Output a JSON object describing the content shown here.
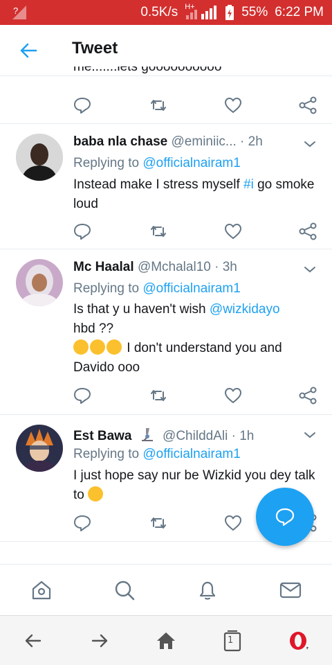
{
  "status_bar": {
    "sim_indicator": "?",
    "network_speed": "0.5K/s",
    "network_type": "H+",
    "battery": "55%",
    "time": "6:22 PM",
    "accent": "#d32f2f"
  },
  "header": {
    "title": "Tweet",
    "back_icon": "arrow-left-icon"
  },
  "previous_tweet": {
    "partial_text": "me.......lets goooooooooo"
  },
  "tweets": [
    {
      "name": "baba nla chase",
      "handle": "@eminiic...",
      "separator": "·",
      "time": "2h",
      "replying_prefix": "Replying to",
      "replying_to": "@officialnairam1",
      "text_before": "Instead make I stress myself ",
      "hashtag": "#i",
      "text_after": " go smoke loud"
    },
    {
      "name": "Mc Haalal",
      "handle": "@Mchalal10",
      "separator": "·",
      "time": "3h",
      "replying_prefix": "Replying to",
      "replying_to": "@officialnairam1",
      "text_before": "Is that y u haven't wish ",
      "mention": "@wizkidayo",
      "text_line2": "hbd ??",
      "text_line3": " I don't understand you and Davido ooo"
    },
    {
      "name": "Est Bawa",
      "name_icon": "microscope-icon",
      "handle": "@ChilddAli",
      "separator": "·",
      "time": "1h",
      "replying_prefix": "Replying to",
      "replying_to": "@officialnairam1",
      "text": "I just hope say nur be Wizkid you dey talk to "
    }
  ],
  "action_icons": [
    "reply-icon",
    "retweet-icon",
    "like-icon",
    "share-icon"
  ],
  "fab": {
    "icon": "compose-reply-icon",
    "color": "#1da1f2"
  },
  "bottom_nav": [
    "home-icon",
    "search-icon",
    "notifications-icon",
    "messages-icon"
  ],
  "browser_bar": {
    "tabs_count": "1",
    "icons": [
      "browser-back-icon",
      "browser-forward-icon",
      "browser-home-icon",
      "tabs-icon",
      "opera-menu-icon"
    ]
  },
  "colors": {
    "link": "#1da1f2",
    "secondary_text": "#657786",
    "divider": "#e6ecf0"
  }
}
